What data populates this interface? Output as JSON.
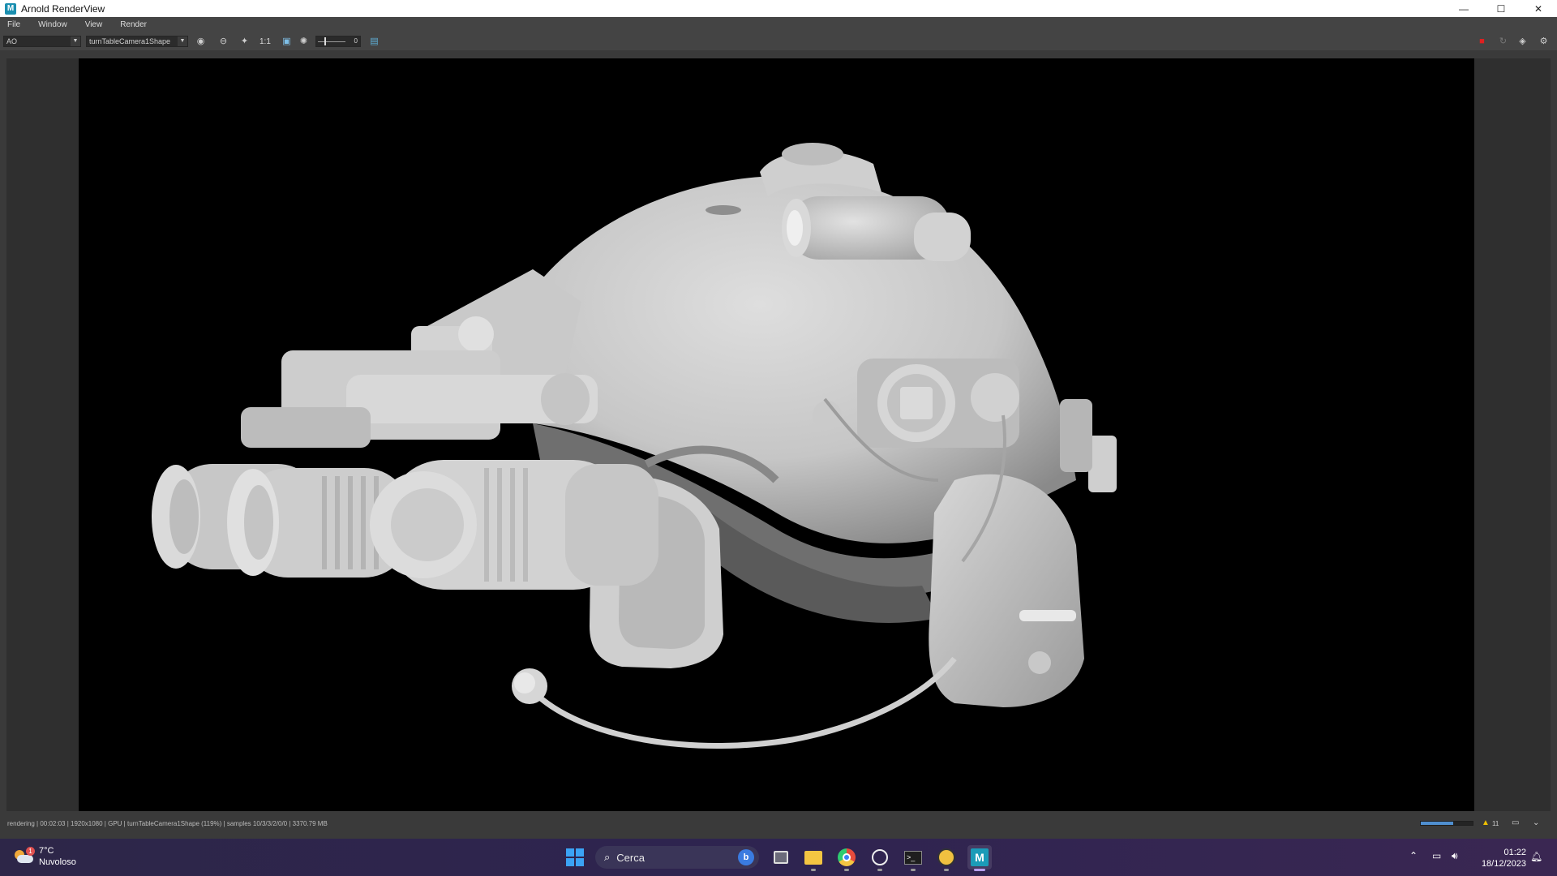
{
  "window": {
    "title": "Arnold RenderView",
    "app_icon_letter": "M",
    "controls": {
      "minimize": "—",
      "maximize": "☐",
      "close": "✕"
    }
  },
  "menu": [
    "File",
    "Window",
    "View",
    "Render"
  ],
  "toolbar": {
    "aov_value": "AO",
    "camera_value": "turnTableCamera1Shape",
    "ratio_label": "1:1",
    "exposure_value": "0"
  },
  "render": {
    "subject": "3D helmet model with night vision goggles, ambient occlusion pass"
  },
  "status": {
    "text": "rendering | 00:02:03 | 1920x1080 | GPU | turnTableCamera1Shape (119%) | samples 10/3/3/2/0/0 | 3370.79 MB",
    "progress_fraction": 0.62,
    "warning_count": "11"
  },
  "taskbar": {
    "weather_temp": "7°C",
    "weather_desc": "Nuvoloso",
    "weather_badge": "1",
    "search_placeholder": "Cerca",
    "search_badge": "b",
    "time": "01:22",
    "date": "18/12/2023",
    "accent": "#b8a0f0"
  }
}
